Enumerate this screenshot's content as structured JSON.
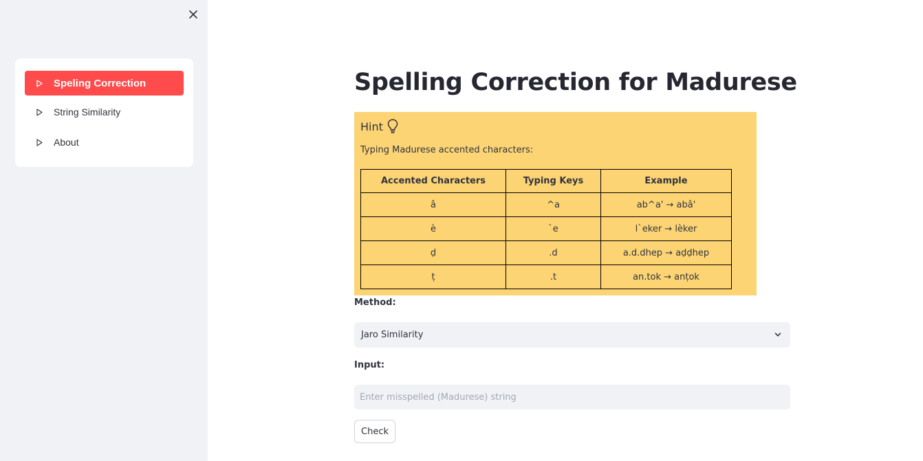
{
  "sidebar": {
    "close_icon": "close-icon",
    "items": [
      {
        "label": "Speling Correction",
        "active": true,
        "icon": "play-triangle-icon"
      },
      {
        "label": "String Similarity",
        "active": false,
        "icon": "play-triangle-icon"
      },
      {
        "label": "About",
        "active": false,
        "icon": "play-triangle-icon"
      }
    ]
  },
  "main": {
    "title": "Spelling Correction for Madurese",
    "hint": {
      "title": "Hint",
      "icon": "lightbulb-icon",
      "text": "Typing Madurese accented characters:",
      "table": {
        "headers": [
          "Accented Characters",
          "Typing Keys",
          "Example"
        ],
        "rows": [
          [
            "â",
            "^a",
            "ab^a' → abâ'"
          ],
          [
            "è",
            "`e",
            "l`eker → lèker"
          ],
          [
            "ḍ",
            ".d",
            "a.d.dhep → aḍḍhep"
          ],
          [
            "ṭ",
            ".t",
            "an.tok → anṭok"
          ]
        ]
      }
    },
    "method_label": "Method:",
    "method_value": "Jaro Similarity",
    "input_label": "Input:",
    "input_placeholder": "Enter misspelled (Madurese) string",
    "input_value": "",
    "check_label": "Check"
  },
  "colors": {
    "accent": "#ff4b4b",
    "hint_background": "#fcd474",
    "sidebar_background": "#f0f2f6",
    "text": "#31333f"
  }
}
